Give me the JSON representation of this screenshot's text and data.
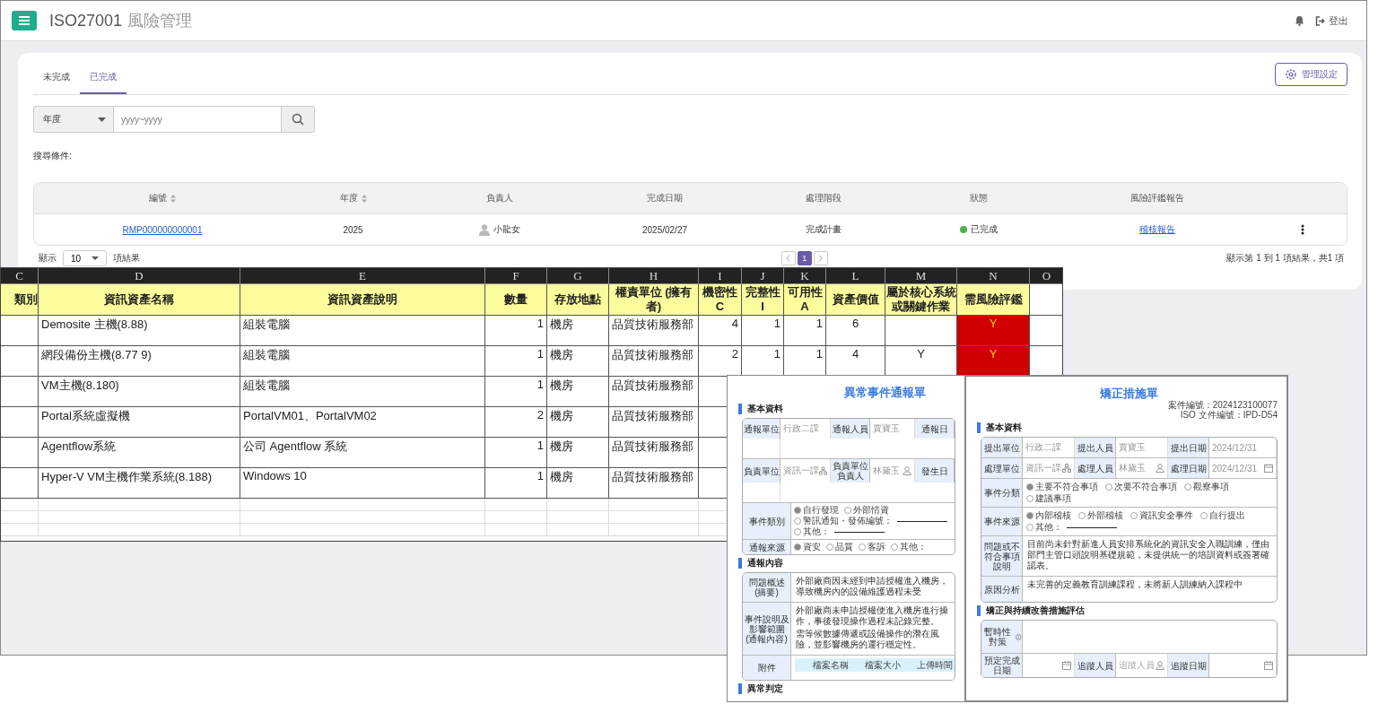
{
  "app": {
    "code": "ISO27001",
    "title": "風險管理",
    "logout": "登出"
  },
  "tabs": [
    {
      "label": "未完成",
      "selected": false
    },
    {
      "label": "已完成",
      "selected": true
    }
  ],
  "settings_button": "管理設定",
  "filter": {
    "select": "年度",
    "placeholder": "yyyy~yyyy"
  },
  "search_conditions_label": "搜尋條件:",
  "table": {
    "columns": [
      {
        "label": "編號",
        "sortable": true
      },
      {
        "label": "年度",
        "sortable": true
      },
      {
        "label": "負責人"
      },
      {
        "label": "完成日期"
      },
      {
        "label": "處理階段"
      },
      {
        "label": "狀態"
      },
      {
        "label": "風險評鑑報告"
      }
    ],
    "rows": [
      {
        "id": "RMP000000000001",
        "year": "2025",
        "owner": "小龍女",
        "date": "2025/02/27",
        "stage": "完成計畫",
        "status": "已完成",
        "color": "#4caf50",
        "report": "稽核報告"
      }
    ]
  },
  "page_size": {
    "prefix": "顯示",
    "value": "10",
    "suffix": "項結果"
  },
  "pagination": [
    {
      "label": "1",
      "selected": true
    }
  ],
  "summary": "顯示第 1 到 1 項結果，共1 項",
  "spreadsheet": {
    "headers": [
      {
        "letter": "C",
        "label": "類別"
      },
      {
        "letter": "D",
        "label": "資訊資產名稱"
      },
      {
        "letter": "E",
        "label": "資訊資產說明"
      },
      {
        "letter": "F",
        "label": "數量"
      },
      {
        "letter": "G",
        "label": "存放地點"
      },
      {
        "letter": "H",
        "label": "權責單位 (擁有者)"
      },
      {
        "letter": "I",
        "label": "機密性 C"
      },
      {
        "letter": "J",
        "label": "完整性 I"
      },
      {
        "letter": "K",
        "label": "可用性 A"
      },
      {
        "letter": "L",
        "label": "資產價值"
      },
      {
        "letter": "M",
        "label": "屬於核心系統或關鍵作業"
      },
      {
        "letter": "N",
        "label": "需風險評鑑"
      },
      {
        "letter": "O"
      }
    ],
    "rows": [
      {
        "name": "Demosite 主機(8.88)",
        "description": "組裝電腦",
        "quantity": "1",
        "location": "機房",
        "owner": "品質技術服務部",
        "c": "4",
        "i": "1",
        "a": "1",
        "value": "6",
        "assess": "Y"
      },
      {
        "name": "網段備份主機(8.77 9)",
        "description": "組裝電腦",
        "quantity": "1",
        "location": "機房",
        "owner": "品質技術服務部",
        "c": "2",
        "i": "1",
        "a": "1",
        "value": "4",
        "core": "Y",
        "assess": "Y"
      },
      {
        "name": "VM主機(8.180)",
        "description": "組裝電腦",
        "quantity": "1",
        "location": "機房",
        "owner": "品質技術服務部"
      },
      {
        "name": "Portal系統虛擬機",
        "description": "PortalVM01、PortalVM02",
        "quantity": "2",
        "location": "機房",
        "owner": "品質技術服務部"
      },
      {
        "name": "Agentflow系統",
        "description": "公司 Agentflow 系統",
        "quantity": "1",
        "location": "機房",
        "owner": "品質技術服務部"
      },
      {
        "name": "Hyper-V VM主機作業系統(8.188)",
        "description": "Windows 10",
        "quantity": "1",
        "location": "機房",
        "owner": "品質技術服務部"
      }
    ]
  },
  "forms": [
    {
      "title": "異常事件通報單",
      "sections": [
        {
          "heading": "基本資料",
          "rows": [
            {
              "kind": "fields",
              "fields": [
                {
                  "label": "通報單位",
                  "value": "行政二課"
                },
                {
                  "label": "通報人員",
                  "value": "賈寶玉"
                },
                {
                  "label": "通報日"
                }
              ]
            },
            {
              "kind": "fields",
              "fields": [
                {
                  "label": "負責單位",
                  "value": "資訊一課"
                },
                {
                  "label": "負責單位負責人",
                  "value": "林黛玉"
                },
                {
                  "label": "發生日"
                }
              ]
            },
            {
              "kind": "options",
              "label": "事件類別",
              "options": [
                {
                  "label": "自行發現",
                  "checked": true
                },
                {
                  "label": "外部情資",
                  "checked": false
                },
                {
                  "label": "警訊通知・發佈編號：",
                  "checked": false,
                  "blank": true
                },
                {
                  "label": "其他：",
                  "checked": false,
                  "blank": true
                }
              ]
            },
            {
              "kind": "options",
              "label": "通報來源",
              "options": [
                {
                  "label": "資安",
                  "checked": true
                },
                {
                  "label": "品質",
                  "checked": false
                },
                {
                  "label": "客訴",
                  "checked": false
                },
                {
                  "label": "其他：",
                  "checked": false
                }
              ]
            }
          ]
        },
        {
          "heading": "通報內容",
          "rows": [
            {
              "kind": "text",
              "label": "問題概述(摘要)",
              "paragraphs": [
                "外部廠商因未經到申請授權進入機房，導致機房內的設備維護過程未受"
              ]
            },
            {
              "kind": "text",
              "label": "事件說明及影響範圍(通報內容)",
              "paragraphs": [
                "外部廠商未申請授權便進入機房進行操作，事後發現操作過程未記錄完整。",
                "需等候數據傳遞或設備操作的潛在風險，並影響機房的運行穩定性。"
              ]
            },
            {
              "kind": "attachment",
              "label": "附件",
              "columns": [
                "檔案名稱",
                "檔案大小",
                "上傳時間"
              ]
            }
          ]
        },
        {
          "heading": "異常判定"
        }
      ]
    },
    {
      "title": "矯正措施單",
      "meta": [
        "案件編號：2024123100077",
        "ISO 文件編號：IPD-D54"
      ],
      "sections": [
        {
          "heading": "基本資料",
          "rows": [
            {
              "kind": "fields",
              "fields": [
                {
                  "label": "提出單位",
                  "value": "行政二課"
                },
                {
                  "label": "提出人員",
                  "value": "賈寶玉"
                },
                {
                  "label": "提出日期",
                  "value": "2024/12/31"
                }
              ]
            },
            {
              "kind": "fields",
              "fields": [
                {
                  "label": "處理單位",
                  "value": "資訊一課"
                },
                {
                  "label": "處理人員",
                  "value": "林黛玉"
                },
                {
                  "label": "處理日期",
                  "value": "2024/12/31"
                }
              ]
            },
            {
              "kind": "options",
              "label": "事件分類",
              "options": [
                {
                  "label": "主要不符合事項",
                  "checked": true
                },
                {
                  "label": "次要不符合事項",
                  "checked": false
                },
                {
                  "label": "觀察事項",
                  "checked": false
                },
                {
                  "label": "建議事項",
                  "checked": false
                }
              ]
            },
            {
              "kind": "options",
              "label": "事件來源",
              "options": [
                {
                  "label": "內部稽核",
                  "checked": true
                },
                {
                  "label": "外部稽核",
                  "checked": false
                },
                {
                  "label": "資訊安全事件",
                  "checked": false
                },
                {
                  "label": "自行提出",
                  "checked": false
                },
                {
                  "label": "其他：",
                  "checked": false,
                  "blank": true
                }
              ]
            },
            {
              "kind": "text",
              "label": "問題或不符合事項說明",
              "paragraphs": [
                "目前尚未針對新進人員安排系統化的資訊安全入職訓練，僅由部門主管口頭說明基礎規範，未提供統一的培訓資料或簽署確認表。"
              ]
            },
            {
              "kind": "text",
              "label": "原因分析",
              "paragraphs": [
                "未完善的定義教育訓練課程，未將新人訓練納入課程中"
              ]
            }
          ]
        },
        {
          "heading": "矯正與持續改善措施評估",
          "rows": [
            {
              "kind": "blank",
              "label": "暫時性對策",
              "info": true
            },
            {
              "kind": "fields",
              "fields": [
                {
                  "label": "預定完成日期"
                },
                {
                  "label": "追蹤人員",
                  "placeholder": "追蹤人員"
                },
                {
                  "label": "追蹤日期"
                }
              ]
            }
          ]
        }
      ]
    }
  ]
}
